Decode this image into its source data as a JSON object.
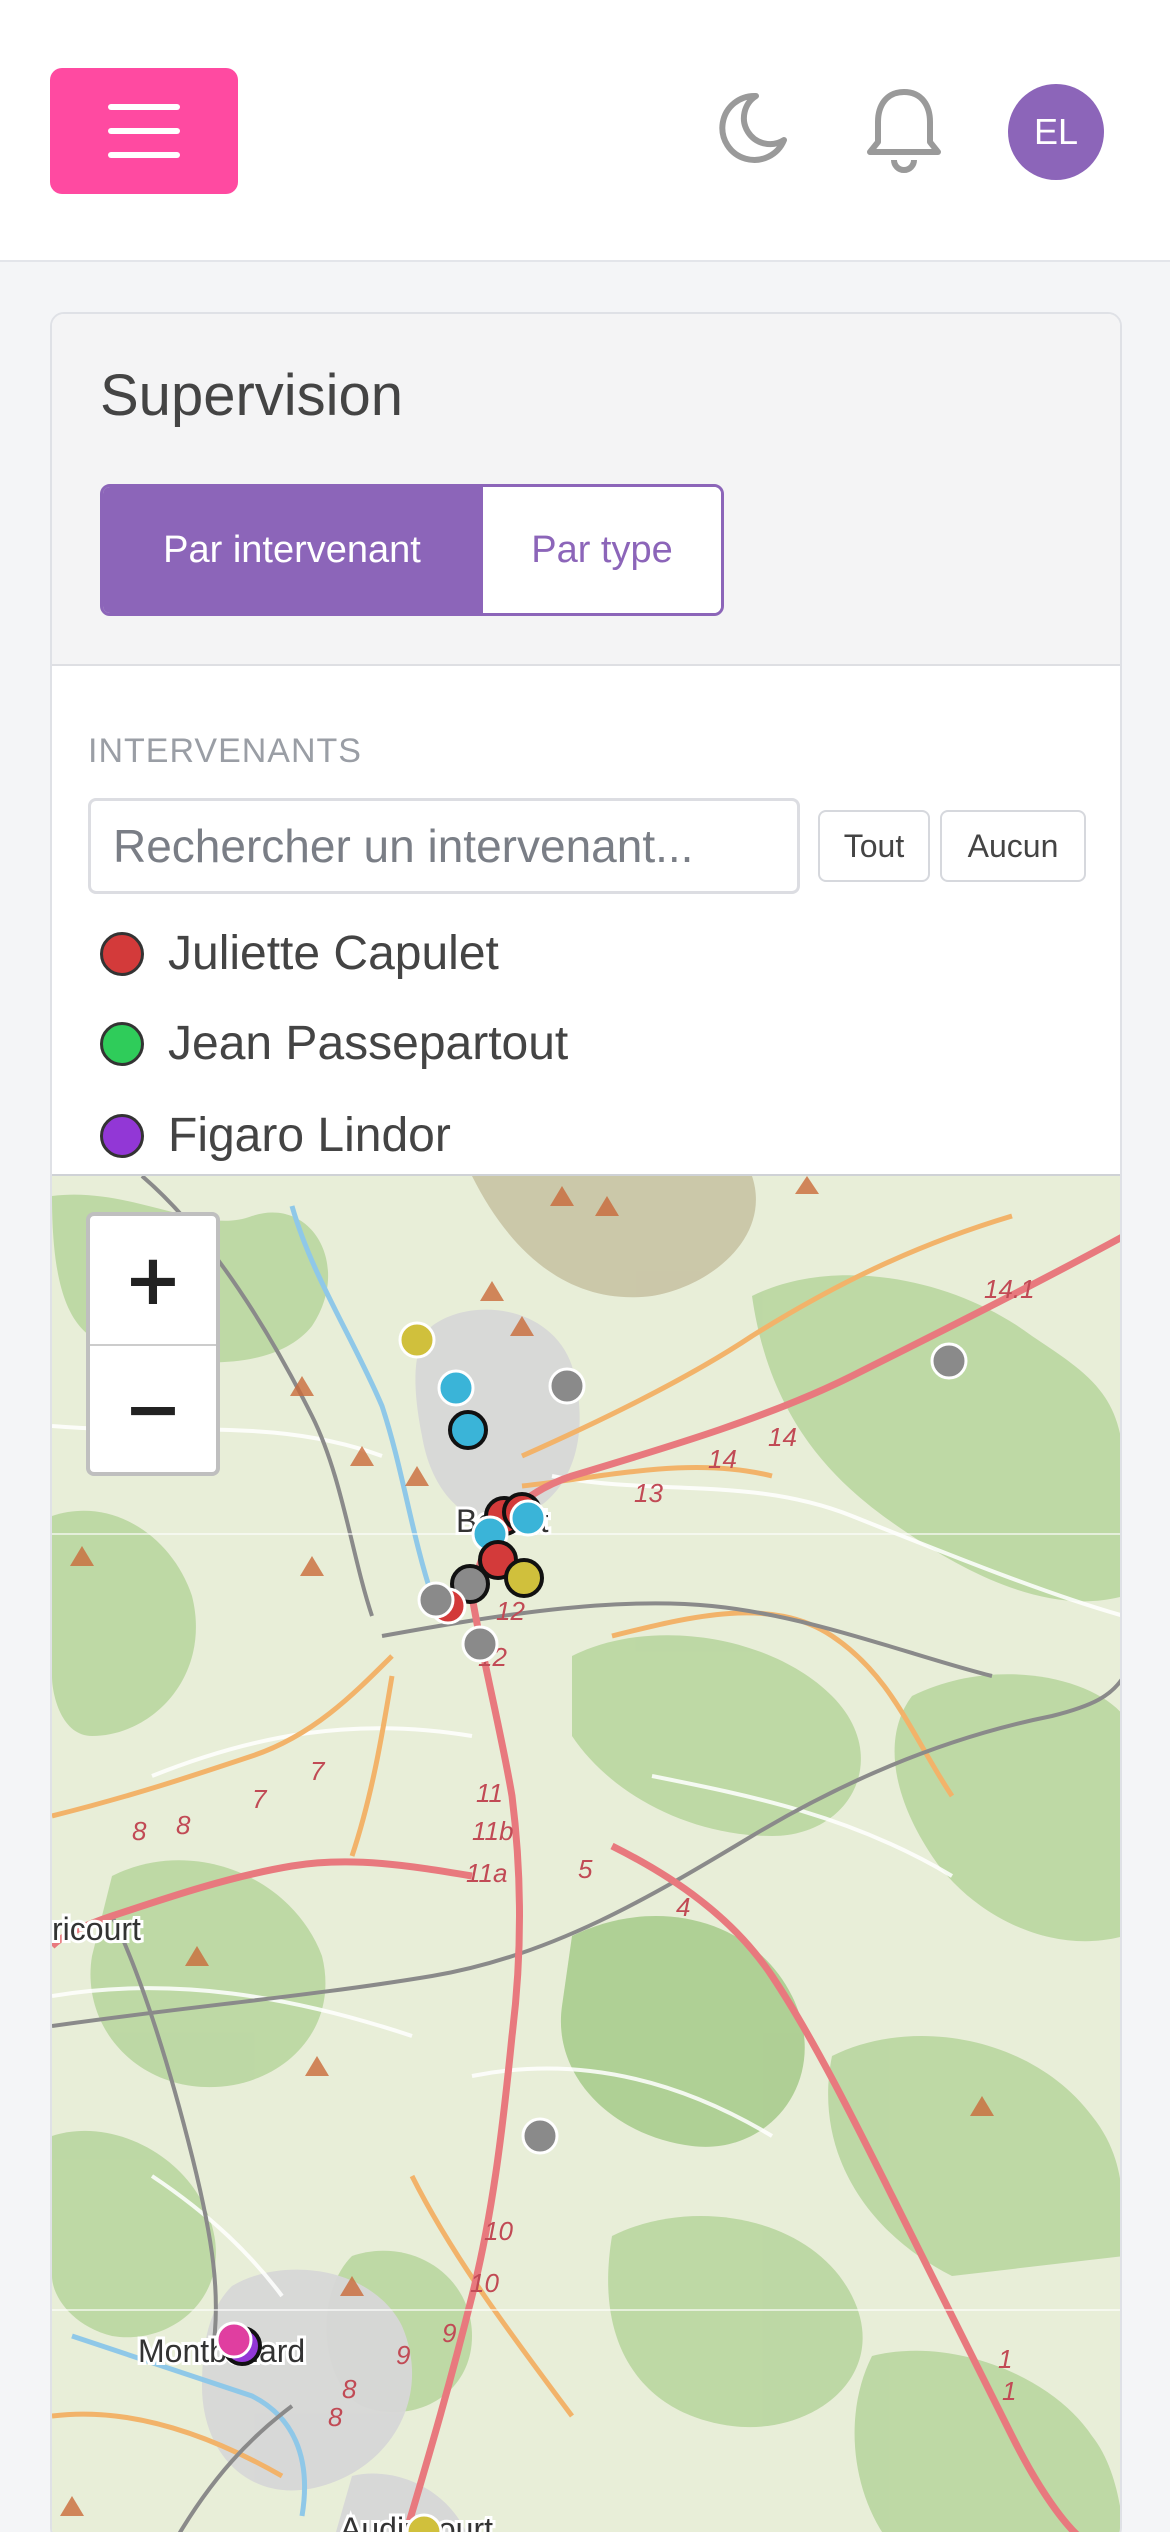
{
  "header": {
    "avatar_initials": "EL",
    "menu_color": "#ff4aa1",
    "accent_color": "#8c65b9"
  },
  "card": {
    "title": "Supervision",
    "view_options": [
      "Par intervenant",
      "Par type"
    ],
    "active_view": "Par intervenant"
  },
  "filters": {
    "section_label": "INTERVENANTS",
    "search_placeholder": "Rechercher un intervenant...",
    "select_all_label": "Tout",
    "select_none_label": "Aucun",
    "people": [
      {
        "name": "Juliette Capulet",
        "color": "#d33a3a"
      },
      {
        "name": "Jean Passepartout",
        "color": "#2fcc5a"
      },
      {
        "name": "Figaro Lindor",
        "color": "#9237d6"
      }
    ]
  },
  "map": {
    "zoom_in_label": "+",
    "zoom_out_label": "−",
    "place_labels": [
      "Belfort",
      "ricourt",
      "Montbéliard",
      "Audincourt"
    ],
    "road_labels": [
      "14.1",
      "14",
      "14",
      "13",
      "12",
      "12",
      "11",
      "11b",
      "11a",
      "7",
      "7",
      "8",
      "8",
      "5",
      "4",
      "10",
      "10",
      "9",
      "9",
      "8",
      "8",
      "1",
      "1"
    ],
    "marker_colors": [
      "#d0c03c",
      "#3ab4d8",
      "#8a8a8a",
      "#d33a3a",
      "#9237d6",
      "#e03ea0"
    ]
  }
}
